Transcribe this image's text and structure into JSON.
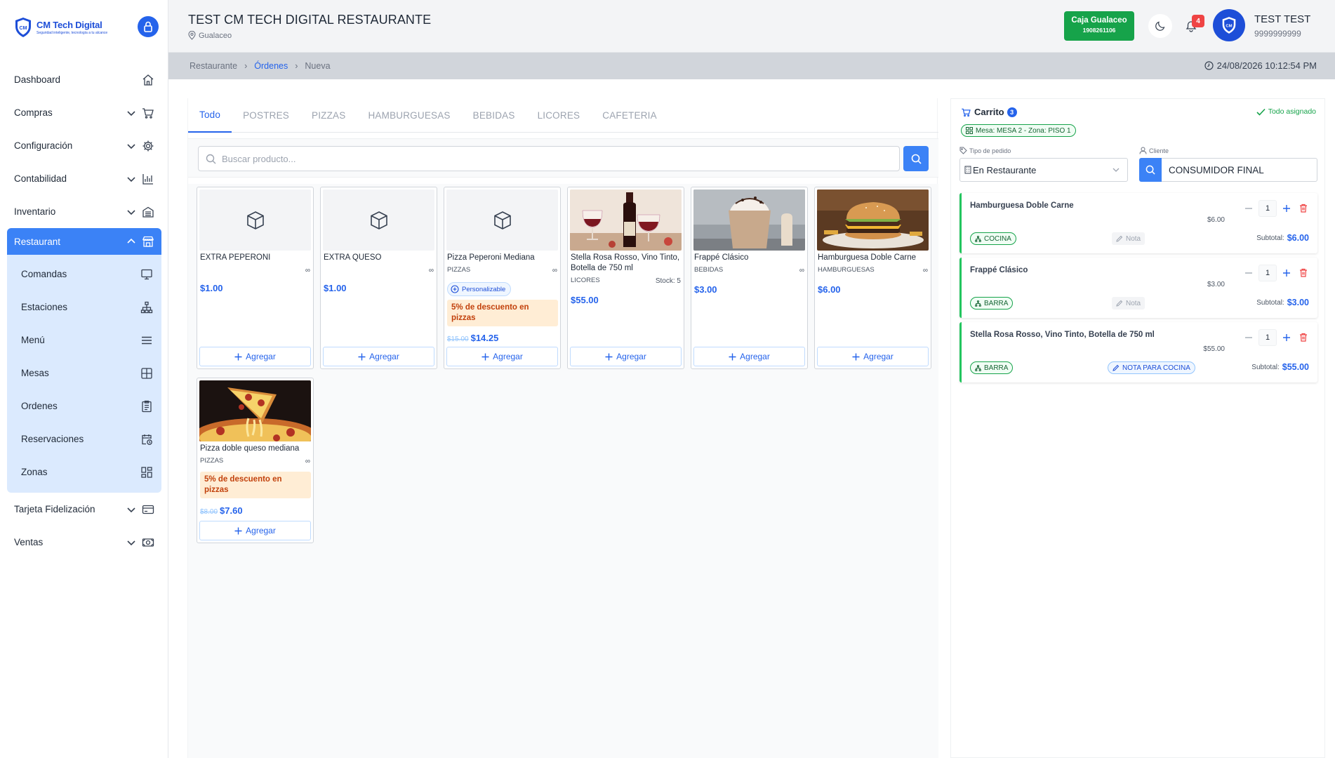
{
  "brand": {
    "title": "CM Tech Digital",
    "tagline": "Seguridad inteligente, tecnología a tu alcance"
  },
  "sidebar": {
    "items": [
      {
        "label": "Dashboard",
        "icon": "home-icon"
      },
      {
        "label": "Compras",
        "icon": "cart-icon"
      },
      {
        "label": "Configuración",
        "icon": "gear-icon"
      },
      {
        "label": "Contabilidad",
        "icon": "bar-chart-icon"
      },
      {
        "label": "Inventario",
        "icon": "warehouse-icon"
      },
      {
        "label": "Restaurant",
        "icon": "store-icon",
        "active": true
      },
      {
        "label": "Tarjeta Fidelización",
        "icon": "card-icon"
      },
      {
        "label": "Ventas",
        "icon": "cash-icon"
      }
    ],
    "restaurant_sub": [
      {
        "label": "Comandas",
        "icon": "monitor-icon"
      },
      {
        "label": "Estaciones",
        "icon": "sitemap-icon"
      },
      {
        "label": "Menú",
        "icon": "menu-lines-icon"
      },
      {
        "label": "Mesas",
        "icon": "table-grid-icon"
      },
      {
        "label": "Ordenes",
        "icon": "clipboard-icon"
      },
      {
        "label": "Reservaciones",
        "icon": "calendar-clock-icon"
      },
      {
        "label": "Zonas",
        "icon": "zones-icon"
      }
    ]
  },
  "header": {
    "title": "TEST CM TECH DIGITAL RESTAURANTE",
    "location": "Gualaceo",
    "caja": {
      "name": "Caja Gualaceo",
      "number": "1908261106"
    },
    "notifications": "4",
    "user_name": "TEST TEST",
    "user_id": "9999999999"
  },
  "breadcrumb": {
    "root": "Restaurante",
    "link": "Órdenes",
    "current": "Nueva",
    "sep": "›"
  },
  "datetime": "24/08/2026 10:12:54 PM",
  "tabs": [
    "Todo",
    "POSTRES",
    "PIZZAS",
    "HAMBURGUESAS",
    "BEBIDAS",
    "LICORES",
    "CAFETERIA"
  ],
  "search": {
    "placeholder": "Buscar producto..."
  },
  "products": [
    {
      "name": "EXTRA PEPERONI",
      "category": "",
      "stock": "∞",
      "price": "$1.00",
      "old_price": "",
      "image": "box-icon",
      "add_label": "Agregar"
    },
    {
      "name": "EXTRA QUESO",
      "category": "",
      "stock": "∞",
      "price": "$1.00",
      "old_price": "",
      "image": "box-icon",
      "add_label": "Agregar"
    },
    {
      "name": "Pizza Peperoni Mediana",
      "category": "PIZZAS",
      "stock": "∞",
      "price": "$14.25",
      "old_price": "$15.00",
      "image": "box-icon",
      "custom": "Personalizable",
      "discount": "5% de descuento en pizzas",
      "add_label": "Agregar"
    },
    {
      "name": "Stella Rosa Rosso, Vino Tinto, Botella de 750 ml",
      "category": "LICORES",
      "stock": "Stock: 5",
      "price": "$55.00",
      "old_price": "",
      "image": "wine-photo",
      "add_label": "Agregar"
    },
    {
      "name": "Frappé Clásico",
      "category": "BEBIDAS",
      "stock": "∞",
      "price": "$3.00",
      "old_price": "",
      "image": "frappe-photo",
      "add_label": "Agregar"
    },
    {
      "name": "Hamburguesa Doble Carne",
      "category": "HAMBURGUESAS",
      "stock": "∞",
      "price": "$6.00",
      "old_price": "",
      "image": "burger-photo",
      "add_label": "Agregar"
    },
    {
      "name": "Pizza doble queso mediana",
      "category": "PIZZAS",
      "stock": "∞",
      "price": "$7.60",
      "old_price": "$8.00",
      "image": "pizza-photo",
      "discount": "5% de descuento en pizzas",
      "add_label": "Agregar"
    }
  ],
  "cart": {
    "title": "Carrito",
    "count": "3",
    "assigned": "Todo asignado",
    "mesa": "Mesa: MESA 2 - Zona: PISO 1",
    "tipo_label": "Tipo de pedido",
    "tipo_value": "En Restaurante",
    "cliente_label": "Cliente",
    "cliente_value": "CONSUMIDOR FINAL",
    "subtotal_label": "Subtotal:",
    "items": [
      {
        "name": "Hamburguesa Doble Carne",
        "unit": "$6.00",
        "qty": "1",
        "station": "COCINA",
        "note": "Nota",
        "subtotal": "$6.00"
      },
      {
        "name": "Frappé Clásico",
        "unit": "$3.00",
        "qty": "1",
        "station": "BARRA",
        "note": "Nota",
        "subtotal": "$3.00"
      },
      {
        "name": "Stella Rosa Rosso, Vino Tinto, Botella de 750 ml",
        "unit": "$55.00",
        "qty": "1",
        "station": "BARRA",
        "note": "NOTA PARA COCINA",
        "subtotal": "$55.00"
      }
    ]
  },
  "colors": {
    "primary": "#3b82f6",
    "success": "#16a34a",
    "danger": "#ef4444",
    "discount_bg": "#ffedd5",
    "discount_text": "#c2410c"
  }
}
